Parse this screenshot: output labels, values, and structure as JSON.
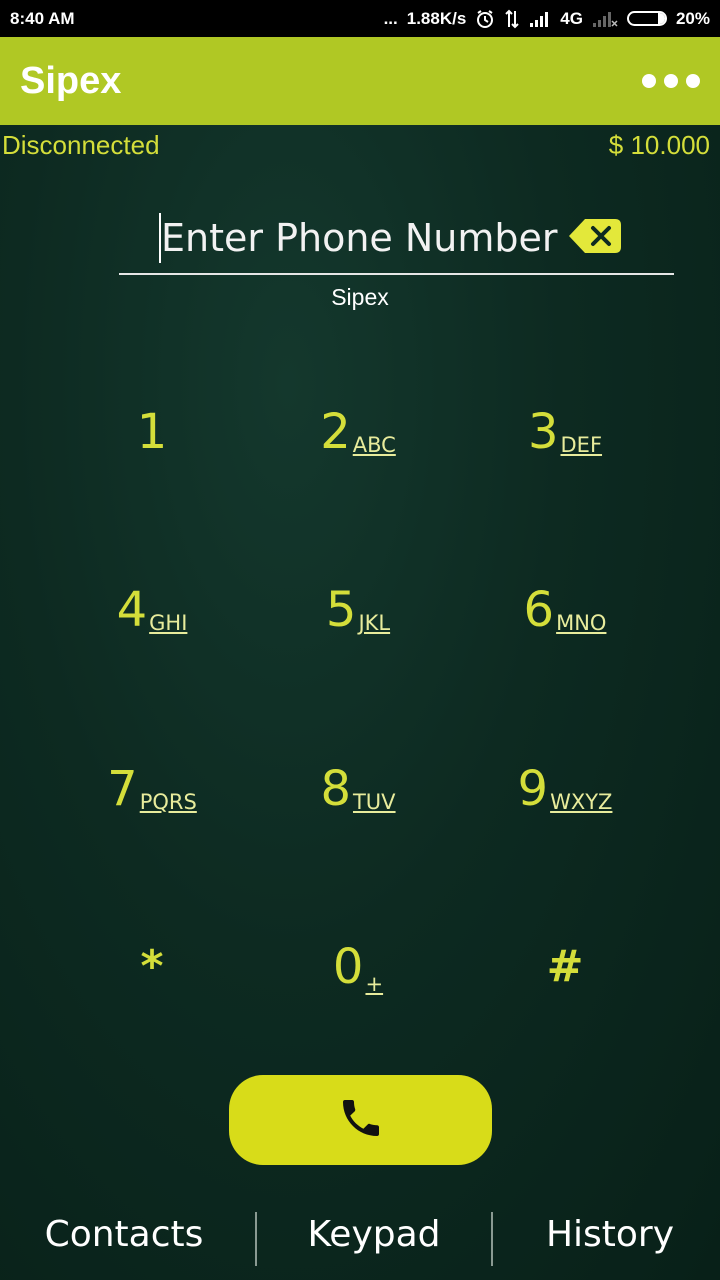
{
  "status_bar": {
    "time": "8:40 AM",
    "dots": "...",
    "speed": "1.88K/s",
    "alarm_icon": "alarm-icon",
    "data_icon": "data-transfer-icon",
    "signal_icon": "signal-icon",
    "network": "4G",
    "battery": "20%",
    "battery_level": 0.2
  },
  "app_bar": {
    "title": "Sipex",
    "menu_icon": "overflow-menu-icon"
  },
  "info": {
    "connection": "Disconnected",
    "balance": "$ 10.000"
  },
  "phone": {
    "placeholder": "Enter Phone Number",
    "value": ""
  },
  "provider": "Sipex",
  "keypad": [
    {
      "digit": "1",
      "letters": ""
    },
    {
      "digit": "2",
      "letters": "ABC"
    },
    {
      "digit": "3",
      "letters": "DEF"
    },
    {
      "digit": "4",
      "letters": "GHI"
    },
    {
      "digit": "5",
      "letters": "JKL"
    },
    {
      "digit": "6",
      "letters": "MNO"
    },
    {
      "digit": "7",
      "letters": "PQRS"
    },
    {
      "digit": "8",
      "letters": "TUV"
    },
    {
      "digit": "9",
      "letters": "WXYZ"
    },
    {
      "digit": "*",
      "letters": ""
    },
    {
      "digit": "0",
      "letters": "+"
    },
    {
      "digit": "#",
      "letters": ""
    }
  ],
  "call_icon": "phone-icon",
  "nav": {
    "contacts": "Contacts",
    "keypad": "Keypad",
    "history": "History"
  },
  "colors": {
    "app_bar": "#b0c824",
    "accent": "#d4de3a",
    "call_button": "#d8dc19",
    "background": "#0d2a21"
  }
}
